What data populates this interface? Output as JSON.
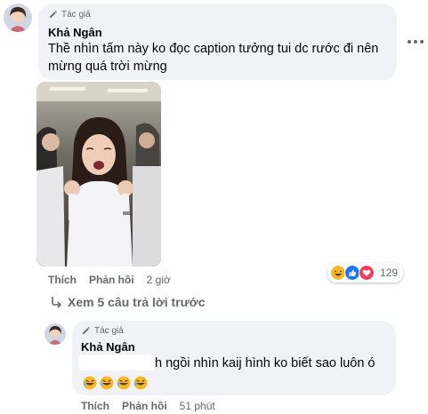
{
  "comment": {
    "author_role": "Tác giả",
    "author_name": "Khả Ngân",
    "text": "Thề nhìn tấm này ko đọc caption tưởng tui dc rước đi nên mừng quá trời mừng",
    "actions": {
      "like": "Thích",
      "reply": "Phản hồi",
      "time": "2 giờ"
    },
    "reactions": {
      "icons": [
        "laugh-react-icon",
        "like-react-icon",
        "love-react-icon"
      ],
      "count": "129"
    }
  },
  "view_more": {
    "label": "Xem 5 câu trả lời trước"
  },
  "reply": {
    "author_role": "Tác giả",
    "author_name": "Khả Ngân",
    "text": "h ngồi nhìn kaij hình ko biết sao luôn ó",
    "emoji_icons": [
      "rofl-emoji-icon",
      "rofl-emoji-icon",
      "rofl-emoji-icon",
      "rofl-emoji-icon"
    ],
    "actions": {
      "like": "Thích",
      "reply": "Phản hồi",
      "time": "51 phút"
    }
  },
  "colors": {
    "bubble": "#f0f2f5",
    "secondary_text": "#65676b",
    "like_blue": "#1877f2",
    "love_red": "#f33e58",
    "haha_yellow": "#f7b928"
  }
}
